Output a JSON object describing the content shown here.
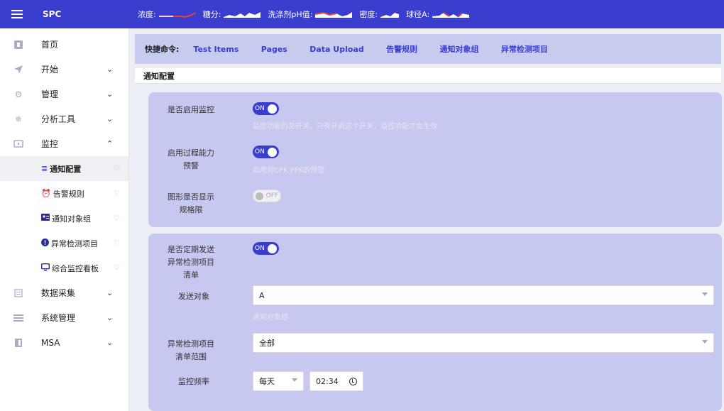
{
  "header": {
    "title": "SPC",
    "metrics": [
      {
        "label": "浓度:"
      },
      {
        "label": "糖分:"
      },
      {
        "label": "洗涤剂pH值:"
      },
      {
        "label": "密度:"
      },
      {
        "label": "球径A:"
      }
    ]
  },
  "sidebar": {
    "items": [
      {
        "label": "首页",
        "icon": "home-icon"
      },
      {
        "label": "开始",
        "icon": "send-icon",
        "chevron": "down"
      },
      {
        "label": "管理",
        "icon": "gear-icon",
        "chevron": "down"
      },
      {
        "label": "分析工具",
        "icon": "sparkle-icon",
        "chevron": "down"
      },
      {
        "label": "监控",
        "icon": "monitor-icon",
        "chevron": "up"
      }
    ],
    "sub_items": [
      {
        "label": "通知配置",
        "icon": "sliders-icon",
        "active": true
      },
      {
        "label": "告警规则",
        "icon": "alarm-icon"
      },
      {
        "label": "通知对象组",
        "icon": "contact-card-icon"
      },
      {
        "label": "异常检测项目",
        "icon": "alert-circle-icon"
      },
      {
        "label": "综合监控看板",
        "icon": "display-icon"
      }
    ],
    "bottom_items": [
      {
        "label": "数据采集",
        "icon": "data-icon",
        "chevron": "down"
      },
      {
        "label": "系统管理",
        "icon": "list-icon",
        "chevron": "down"
      },
      {
        "label": "MSA",
        "icon": "ruler-icon",
        "chevron": "down"
      }
    ]
  },
  "quick": {
    "title": "快捷命令:",
    "items": [
      "Test Items",
      "Pages",
      "Data Upload",
      "告警规则",
      "通知对象组",
      "异常检测项目"
    ]
  },
  "section": {
    "title": "通知配置"
  },
  "form": {
    "enable_monitor": {
      "label": "是否启用监控",
      "state": "ON",
      "hint": "监控功能的总开关，只有开启这个开关，监控功能才会生效"
    },
    "process_capability": {
      "label_1": "启用过程能力",
      "label_2": "预警",
      "state": "ON",
      "hint": "启用对CPK PPK的预警"
    },
    "show_spec_limits": {
      "label_1": "图形是否显示",
      "label_2": "规格限",
      "state": "OFF"
    },
    "periodic_send": {
      "label_1": "是否定期发送",
      "label_2": "异常检测项目",
      "label_3": "清单",
      "state": "ON"
    },
    "send_target": {
      "label": "发送对象",
      "value": "A",
      "hint": "通知对象组"
    },
    "scope": {
      "label_1": "异常检测项目",
      "label_2": "清单范围",
      "value": "全部"
    },
    "frequency": {
      "label": "监控频率",
      "period": "每天",
      "time": "02:34"
    }
  },
  "colors": {
    "accent": "#3a3ecf",
    "panel": "#c6c8ef",
    "quick_bar": "#c8cbf0"
  }
}
